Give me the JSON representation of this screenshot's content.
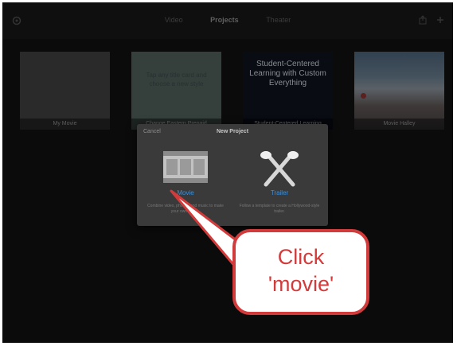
{
  "topbar": {
    "tabs": [
      {
        "label": "Video"
      },
      {
        "label": "Projects"
      },
      {
        "label": "Theater"
      }
    ]
  },
  "projects": [
    {
      "title": "My Movie"
    },
    {
      "title": "Change Eastern Prepaid",
      "preview_text": "Tap any title card and choose a new style"
    },
    {
      "title": "Student-Centered Learning",
      "preview_text": "Student-Centered Learning with Custom Everything"
    },
    {
      "title": "Movie Halley"
    }
  ],
  "modal": {
    "cancel": "Cancel",
    "title": "New Project",
    "options": [
      {
        "label": "Movie",
        "description": "Combine video, photos, and music to make your own movie."
      },
      {
        "label": "Trailer",
        "description": "Follow a template to create a Hollywood-style trailer."
      }
    ]
  },
  "callout": {
    "line1": "Click",
    "line2": "'movie'"
  },
  "colors": {
    "accent": "#3f8fd6",
    "callout": "#d23b3b"
  }
}
